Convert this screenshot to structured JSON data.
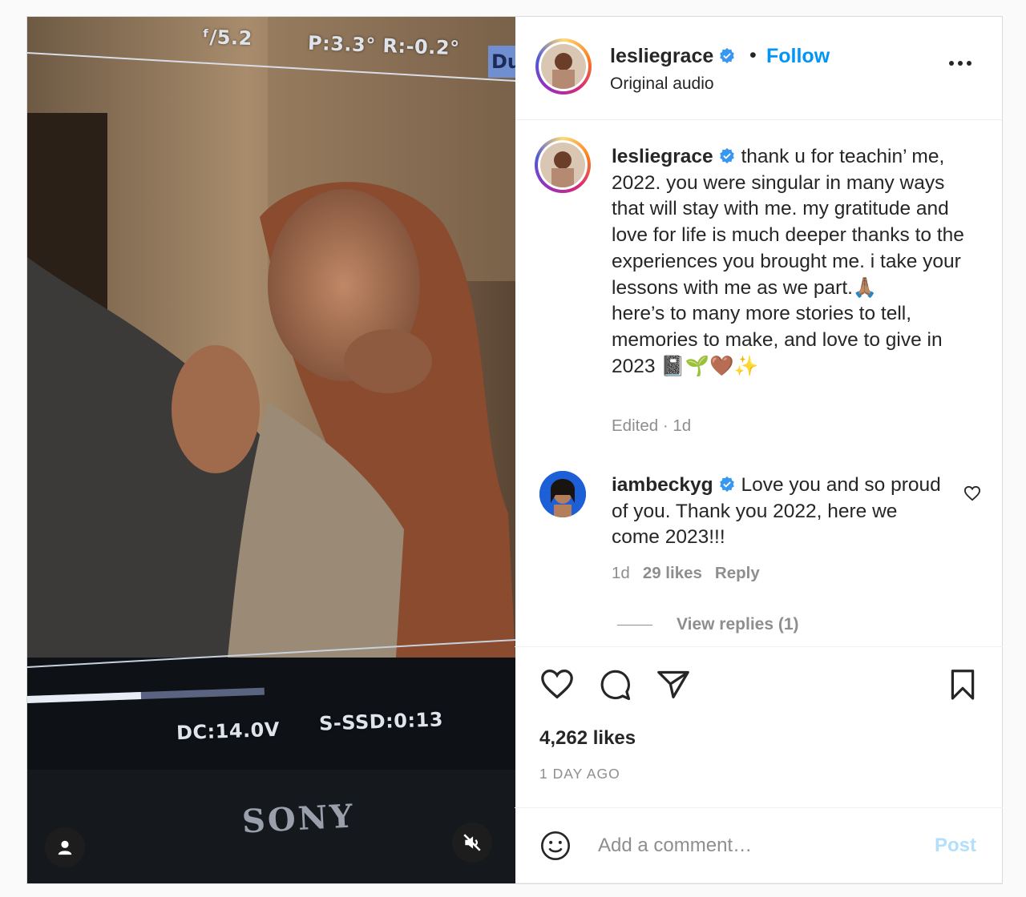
{
  "media": {
    "hud": {
      "fstop": "ᶠ/5.2",
      "pan_roll": "P:3.3° R:-0.2°",
      "du": "Du",
      "voltage": "DC:14.0V",
      "ssd": "S-SSD:0:13"
    },
    "brand": "SONY",
    "progress": 0.48,
    "icons": {
      "tag": "person-tag-icon",
      "mute": "speaker-muted-icon"
    }
  },
  "header": {
    "username": "lesliegrace",
    "separator": "•",
    "follow_label": "Follow",
    "audio": "Original audio",
    "icons": {
      "verified": "verified-badge-icon",
      "more": "more-options-icon"
    }
  },
  "caption": {
    "username": "lesliegrace",
    "text": " thank u for teachin’ me, 2022. you were singular in many ways that will stay with me. my gratitude and love for life is much deeper thanks to the experiences you brought me. i take your lessons with me as we part.🙏🏽",
    "text2": "here’s to many more stories to tell, memories to make, and love to give in 2023 📓🌱🤎✨",
    "meta": "Edited · 1d"
  },
  "comment": {
    "username": "iambeckyg",
    "text": " Love you and so proud of you. Thank you 2022, here we come 2023!!!",
    "time": "1d",
    "likes": "29 likes",
    "reply_label": "Reply",
    "view_replies": "View replies (1)"
  },
  "actions": {
    "icons": [
      "heart-icon",
      "comment-icon",
      "share-icon",
      "bookmark-icon"
    ],
    "likes": "4,262 likes",
    "time_ago": "1 DAY AGO"
  },
  "composer": {
    "placeholder": "Add a comment…",
    "post_label": "Post"
  },
  "colors": {
    "accent": "#0095f6",
    "post_disabled": "#b2dffc",
    "muted": "#8e8e8e",
    "text": "#262626"
  }
}
